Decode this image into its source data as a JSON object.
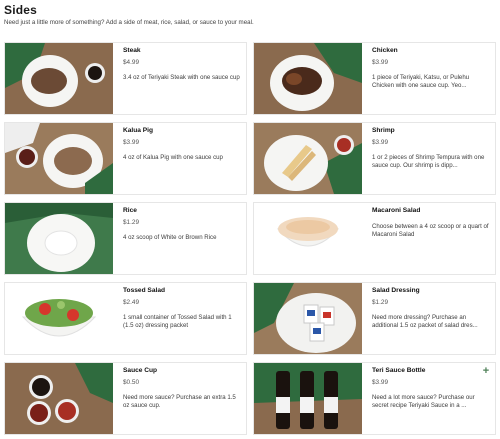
{
  "header": {
    "title": "Sides",
    "subtitle": "Need just a little more of something? Add a side of meat, rice, salad, or sauce to your meal."
  },
  "items": [
    {
      "name": "Steak",
      "price": "$4.99",
      "description": "3.4 oz of Teriyaki Steak with one sauce cup"
    },
    {
      "name": "Chicken",
      "price": "$3.99",
      "description": "1 piece of Teriyaki, Katsu, or Pulehu Chicken with one sauce cup. Yeo..."
    },
    {
      "name": "Kalua Pig",
      "price": "$3.99",
      "description": "4 oz of Kalua Pig with one sauce cup"
    },
    {
      "name": "Shrimp",
      "price": "$3.99",
      "description": "1 or 2 pieces of Shrimp Tempura with one sauce cup. Our shrimp is dipp..."
    },
    {
      "name": "Rice",
      "price": "$1.29",
      "description": "4 oz scoop of White or Brown Rice"
    },
    {
      "name": "Macaroni Salad",
      "price": "",
      "description": "Choose between a 4 oz scoop or a quart of Macaroni Salad"
    },
    {
      "name": "Tossed Salad",
      "price": "$2.49",
      "description": "1 small container of Tossed Salad with 1 (1.5 oz) dressing packet"
    },
    {
      "name": "Salad Dressing",
      "price": "$1.29",
      "description": "Need more dressing? Purchase an additional 1.5 oz packet of salad dres..."
    },
    {
      "name": "Sauce Cup",
      "price": "$0.50",
      "description": "Need more sauce? Purchase an extra 1.5 oz sauce cup."
    },
    {
      "name": "Teri Sauce Bottle",
      "price": "$3.99",
      "description": "Need a lot more sauce? Purchase our secret recipe Teriyaki Sauce in a ..."
    }
  ],
  "add_label": "+",
  "colors": {
    "leaf": "#2f6b3e",
    "wood": "#8a6a4e",
    "accent": "#4d7f57"
  }
}
